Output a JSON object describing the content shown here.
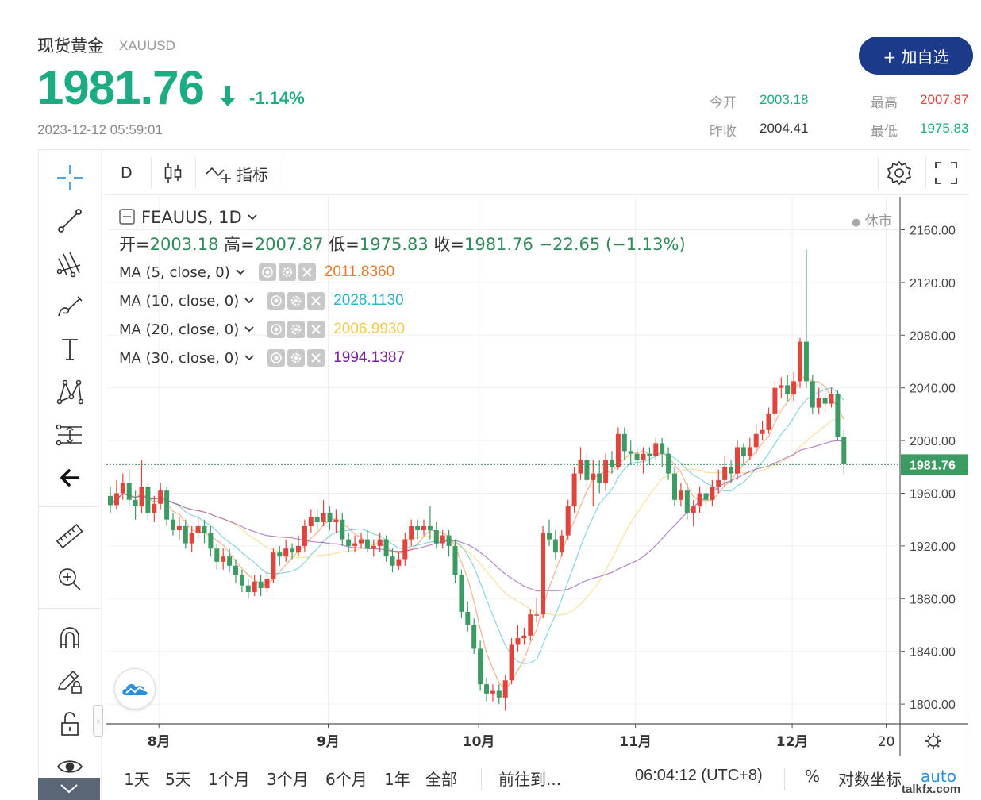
{
  "header": {
    "asset_name": "现货黄金",
    "asset_code": "XAUUSD",
    "price": "1981.76",
    "change_pct": "-1.14%",
    "timestamp": "2023-12-12 05:59:01",
    "add_button": "+ 加自选",
    "stats": {
      "open_label": "今开",
      "open_value": "2003.18",
      "high_label": "最高",
      "high_value": "2007.87",
      "prev_close_label": "昨收",
      "prev_close_value": "2004.41",
      "low_label": "最低",
      "low_value": "1975.83"
    },
    "colors": {
      "up": "#e0443c",
      "down": "#1dab84",
      "brand": "#1c3a8a"
    }
  },
  "toolbar": {
    "interval": "D",
    "indicators_label": "指标"
  },
  "left_tools": [
    "crosshair-icon",
    "trend-line-icon",
    "pitchfork-icon",
    "brush-icon",
    "text-icon",
    "pattern-icon",
    "measure-icon",
    "back-arrow-icon",
    "ruler-icon",
    "zoom-in-icon",
    "magnet-icon",
    "lock-drawing-icon",
    "unlock-icon",
    "eye-icon",
    "chevron-down-icon"
  ],
  "legend": {
    "symbol": "FEAUUS, 1D",
    "market_status": "休市",
    "ohlc": {
      "o_label": "开=",
      "o": "2003.18",
      "h_label": "高=",
      "h": "2007.87",
      "l_label": "低=",
      "l": "1975.83",
      "c_label": "收=",
      "c": "1981.76",
      "change": "−22.65 (−1.13%)"
    },
    "ma": [
      {
        "label": "MA (5, close, 0)",
        "value": "2011.8360",
        "color": "#e8772e"
      },
      {
        "label": "MA (10, close, 0)",
        "value": "2028.1130",
        "color": "#26b5c6"
      },
      {
        "label": "MA (20, close, 0)",
        "value": "2006.9930",
        "color": "#f2c94c"
      },
      {
        "label": "MA (30, close, 0)",
        "value": "1994.1387",
        "color": "#7b1fa2"
      }
    ]
  },
  "chart_data": {
    "type": "candlestick",
    "symbol": "FEAUUS",
    "interval": "1D",
    "y_ticks": [
      1800,
      1840,
      1880,
      1920,
      1960,
      2000,
      2040,
      2080,
      2120,
      2160
    ],
    "ylim": [
      1785,
      2185
    ],
    "x_ticks": [
      "8月",
      "9月",
      "10月",
      "11月",
      "12月",
      "20"
    ],
    "last_price": "1981.76",
    "candles": [
      [
        1958,
        1951,
        1965,
        1945
      ],
      [
        1951,
        1960,
        1970,
        1948
      ],
      [
        1960,
        1968,
        1975,
        1955
      ],
      [
        1968,
        1955,
        1978,
        1950
      ],
      [
        1955,
        1950,
        1962,
        1940
      ],
      [
        1950,
        1965,
        1985,
        1945
      ],
      [
        1965,
        1945,
        1968,
        1940
      ],
      [
        1945,
        1952,
        1958,
        1938
      ],
      [
        1952,
        1962,
        1968,
        1948
      ],
      [
        1962,
        1940,
        1965,
        1935
      ],
      [
        1940,
        1932,
        1945,
        1928
      ],
      [
        1932,
        1935,
        1942,
        1925
      ],
      [
        1935,
        1922,
        1940,
        1918
      ],
      [
        1922,
        1930,
        1935,
        1915
      ],
      [
        1930,
        1935,
        1942,
        1925
      ],
      [
        1935,
        1930,
        1940,
        1922
      ],
      [
        1930,
        1918,
        1935,
        1912
      ],
      [
        1918,
        1908,
        1922,
        1902
      ],
      [
        1908,
        1912,
        1918,
        1902
      ],
      [
        1912,
        1905,
        1918,
        1900
      ],
      [
        1905,
        1898,
        1910,
        1892
      ],
      [
        1898,
        1890,
        1902,
        1885
      ],
      [
        1890,
        1885,
        1895,
        1880
      ],
      [
        1885,
        1893,
        1898,
        1882
      ],
      [
        1893,
        1888,
        1898,
        1882
      ],
      [
        1888,
        1895,
        1900,
        1885
      ],
      [
        1895,
        1915,
        1918,
        1892
      ],
      [
        1915,
        1912,
        1920,
        1905
      ],
      [
        1912,
        1918,
        1925,
        1908
      ],
      [
        1918,
        1915,
        1922,
        1910
      ],
      [
        1915,
        1920,
        1928,
        1912
      ],
      [
        1920,
        1935,
        1940,
        1915
      ],
      [
        1935,
        1942,
        1948,
        1930
      ],
      [
        1942,
        1938,
        1948,
        1932
      ],
      [
        1938,
        1945,
        1955,
        1935
      ],
      [
        1945,
        1938,
        1950,
        1932
      ],
      [
        1938,
        1940,
        1948,
        1930
      ],
      [
        1940,
        1925,
        1945,
        1920
      ],
      [
        1925,
        1920,
        1930,
        1915
      ],
      [
        1920,
        1922,
        1928,
        1915
      ],
      [
        1922,
        1925,
        1930,
        1918
      ],
      [
        1925,
        1918,
        1932,
        1915
      ],
      [
        1918,
        1920,
        1925,
        1912
      ],
      [
        1920,
        1925,
        1930,
        1915
      ],
      [
        1925,
        1912,
        1928,
        1908
      ],
      [
        1912,
        1905,
        1918,
        1900
      ],
      [
        1905,
        1910,
        1915,
        1902
      ],
      [
        1910,
        1925,
        1930,
        1905
      ],
      [
        1925,
        1935,
        1940,
        1920
      ],
      [
        1935,
        1932,
        1940,
        1925
      ],
      [
        1932,
        1935,
        1940,
        1928
      ],
      [
        1935,
        1932,
        1950,
        1925
      ],
      [
        1932,
        1922,
        1938,
        1918
      ],
      [
        1922,
        1928,
        1932,
        1918
      ],
      [
        1928,
        1920,
        1932,
        1912
      ],
      [
        1920,
        1898,
        1925,
        1892
      ],
      [
        1898,
        1870,
        1902,
        1865
      ],
      [
        1870,
        1860,
        1878,
        1855
      ],
      [
        1860,
        1842,
        1865,
        1838
      ],
      [
        1842,
        1815,
        1848,
        1810
      ],
      [
        1815,
        1808,
        1820,
        1802
      ],
      [
        1808,
        1810,
        1815,
        1802
      ],
      [
        1810,
        1805,
        1815,
        1800
      ],
      [
        1805,
        1818,
        1822,
        1795
      ],
      [
        1818,
        1845,
        1850,
        1815
      ],
      [
        1845,
        1850,
        1860,
        1840
      ],
      [
        1850,
        1852,
        1858,
        1845
      ],
      [
        1852,
        1868,
        1872,
        1848
      ],
      [
        1868,
        1868,
        1880,
        1862
      ],
      [
        1868,
        1930,
        1935,
        1865
      ],
      [
        1930,
        1925,
        1940,
        1920
      ],
      [
        1925,
        1915,
        1932,
        1910
      ],
      [
        1915,
        1928,
        1932,
        1912
      ],
      [
        1928,
        1950,
        1955,
        1925
      ],
      [
        1950,
        1975,
        1980,
        1945
      ],
      [
        1975,
        1985,
        1995,
        1970
      ],
      [
        1985,
        1970,
        1990,
        1965
      ],
      [
        1970,
        1975,
        1985,
        1950
      ],
      [
        1975,
        1968,
        1985,
        1960
      ],
      [
        1968,
        1985,
        1990,
        1962
      ],
      [
        1985,
        1980,
        1992,
        1975
      ],
      [
        1980,
        2005,
        2010,
        1978
      ],
      [
        2005,
        1992,
        2010,
        1985
      ],
      [
        1992,
        1990,
        2000,
        1982
      ],
      [
        1990,
        1985,
        1995,
        1980
      ],
      [
        1985,
        1990,
        1995,
        1975
      ],
      [
        1990,
        1988,
        1995,
        1982
      ],
      [
        1988,
        1998,
        2002,
        1985
      ],
      [
        1998,
        1990,
        2002,
        1980
      ],
      [
        1990,
        1975,
        1995,
        1970
      ],
      [
        1975,
        1955,
        1980,
        1950
      ],
      [
        1955,
        1962,
        1968,
        1950
      ],
      [
        1962,
        1945,
        1968,
        1940
      ],
      [
        1945,
        1950,
        1955,
        1935
      ],
      [
        1950,
        1960,
        1965,
        1945
      ],
      [
        1960,
        1955,
        1965,
        1948
      ],
      [
        1955,
        1965,
        1970,
        1950
      ],
      [
        1965,
        1970,
        1978,
        1960
      ],
      [
        1970,
        1980,
        1988,
        1965
      ],
      [
        1980,
        1975,
        1985,
        1968
      ],
      [
        1975,
        1995,
        2000,
        1970
      ],
      [
        1995,
        1988,
        1998,
        1982
      ],
      [
        1988,
        1995,
        2002,
        1985
      ],
      [
        1995,
        2005,
        2012,
        1990
      ],
      [
        2005,
        2008,
        2015,
        2000
      ],
      [
        2008,
        2020,
        2025,
        2005
      ],
      [
        2020,
        2040,
        2045,
        2015
      ],
      [
        2040,
        2042,
        2048,
        2032
      ],
      [
        2042,
        2035,
        2050,
        2030
      ],
      [
        2035,
        2045,
        2052,
        2030
      ],
      [
        2045,
        2075,
        2078,
        2040
      ],
      [
        2075,
        2045,
        2145,
        2040
      ],
      [
        2045,
        2025,
        2050,
        2020
      ],
      [
        2025,
        2032,
        2040,
        2020
      ],
      [
        2032,
        2028,
        2038,
        2022
      ],
      [
        2028,
        2035,
        2040,
        2025
      ],
      [
        2035,
        2003,
        2038,
        2000
      ],
      [
        2003,
        1982,
        2008,
        1975
      ]
    ],
    "series": [
      {
        "name": "MA (5, close, 0)",
        "period": 5
      },
      {
        "name": "MA (10, close, 0)",
        "period": 10
      },
      {
        "name": "MA (20, close, 0)",
        "period": 20
      },
      {
        "name": "MA (30, close, 0)",
        "period": 30
      }
    ]
  },
  "bottom_bar": {
    "ranges": [
      "1天",
      "5天",
      "1个月",
      "3个月",
      "6个月",
      "1年",
      "全部"
    ],
    "goto": "前往到...",
    "clock": "06:04:12 (UTC+8)",
    "percent": "%",
    "log": "对数坐标",
    "auto": "auto"
  },
  "watermark": "talkfx.com"
}
